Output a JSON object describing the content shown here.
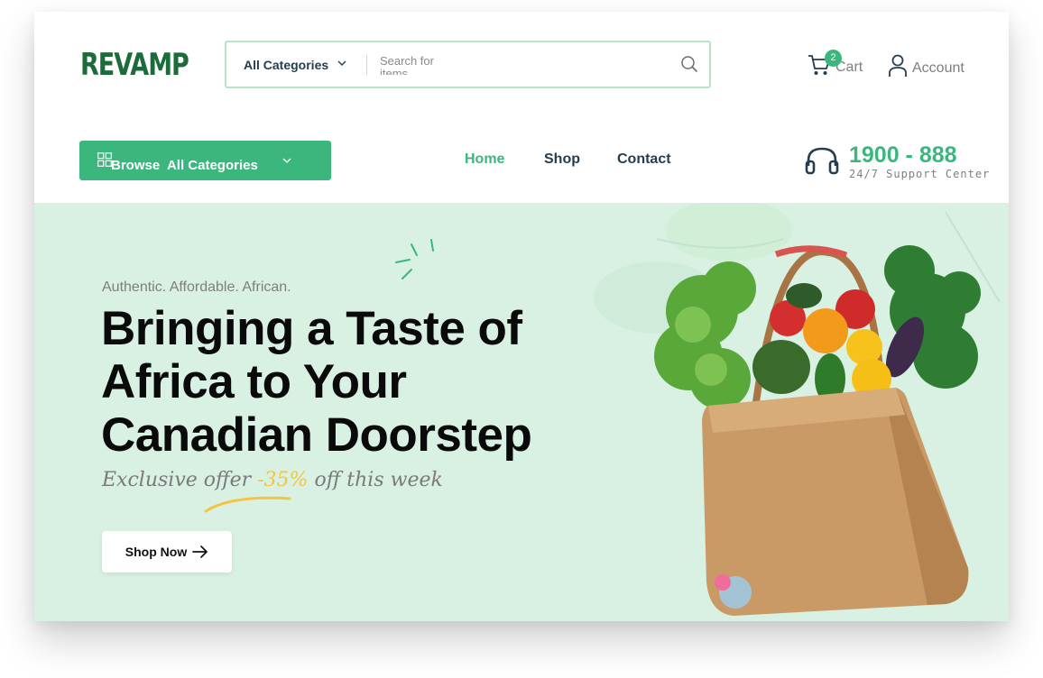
{
  "brand": {
    "logo_text": "REVAMP",
    "accent": "#3bb77e",
    "hero_bg": "#d8f1e3"
  },
  "search": {
    "category_value": "All Categories",
    "placeholder": "Search for items..."
  },
  "header": {
    "cart_label": "Cart",
    "cart_count": "2",
    "account_label": "Account"
  },
  "nav": {
    "browse_label": "Browse  All Categories",
    "items": [
      {
        "label": "Home",
        "active": true
      },
      {
        "label": "Shop",
        "active": false
      },
      {
        "label": "Contact",
        "active": false
      }
    ]
  },
  "support": {
    "number": "1900 - 888",
    "label": "24/7 Support Center"
  },
  "hero": {
    "tagline": "Authentic. Affordable. African.",
    "title": "Bringing a Taste of Africa to Your Canadian Doorstep",
    "offer_prefix": "Exclusive offer ",
    "offer_pct": "-35%",
    "offer_suffix": " off this week",
    "cta_label": "Shop Now",
    "image_icon": "grocery-bag-icon"
  }
}
